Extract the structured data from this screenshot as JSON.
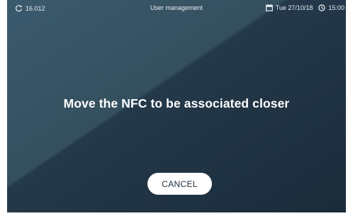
{
  "status_bar": {
    "left_icon": "refresh-icon",
    "left_value": "16.012",
    "title": "User management",
    "date_icon": "calendar-icon",
    "date": "Tue 27/10/18",
    "time_icon": "clock-icon",
    "time": "15:00"
  },
  "main": {
    "message": "Move the NFC to be associated closer",
    "cancel_label": "CANCEL"
  },
  "colors": {
    "background_light": "#3b5a6e",
    "background_dark": "#1a2b3a",
    "button_background": "#ffffff",
    "button_text": "#1d2c38"
  }
}
